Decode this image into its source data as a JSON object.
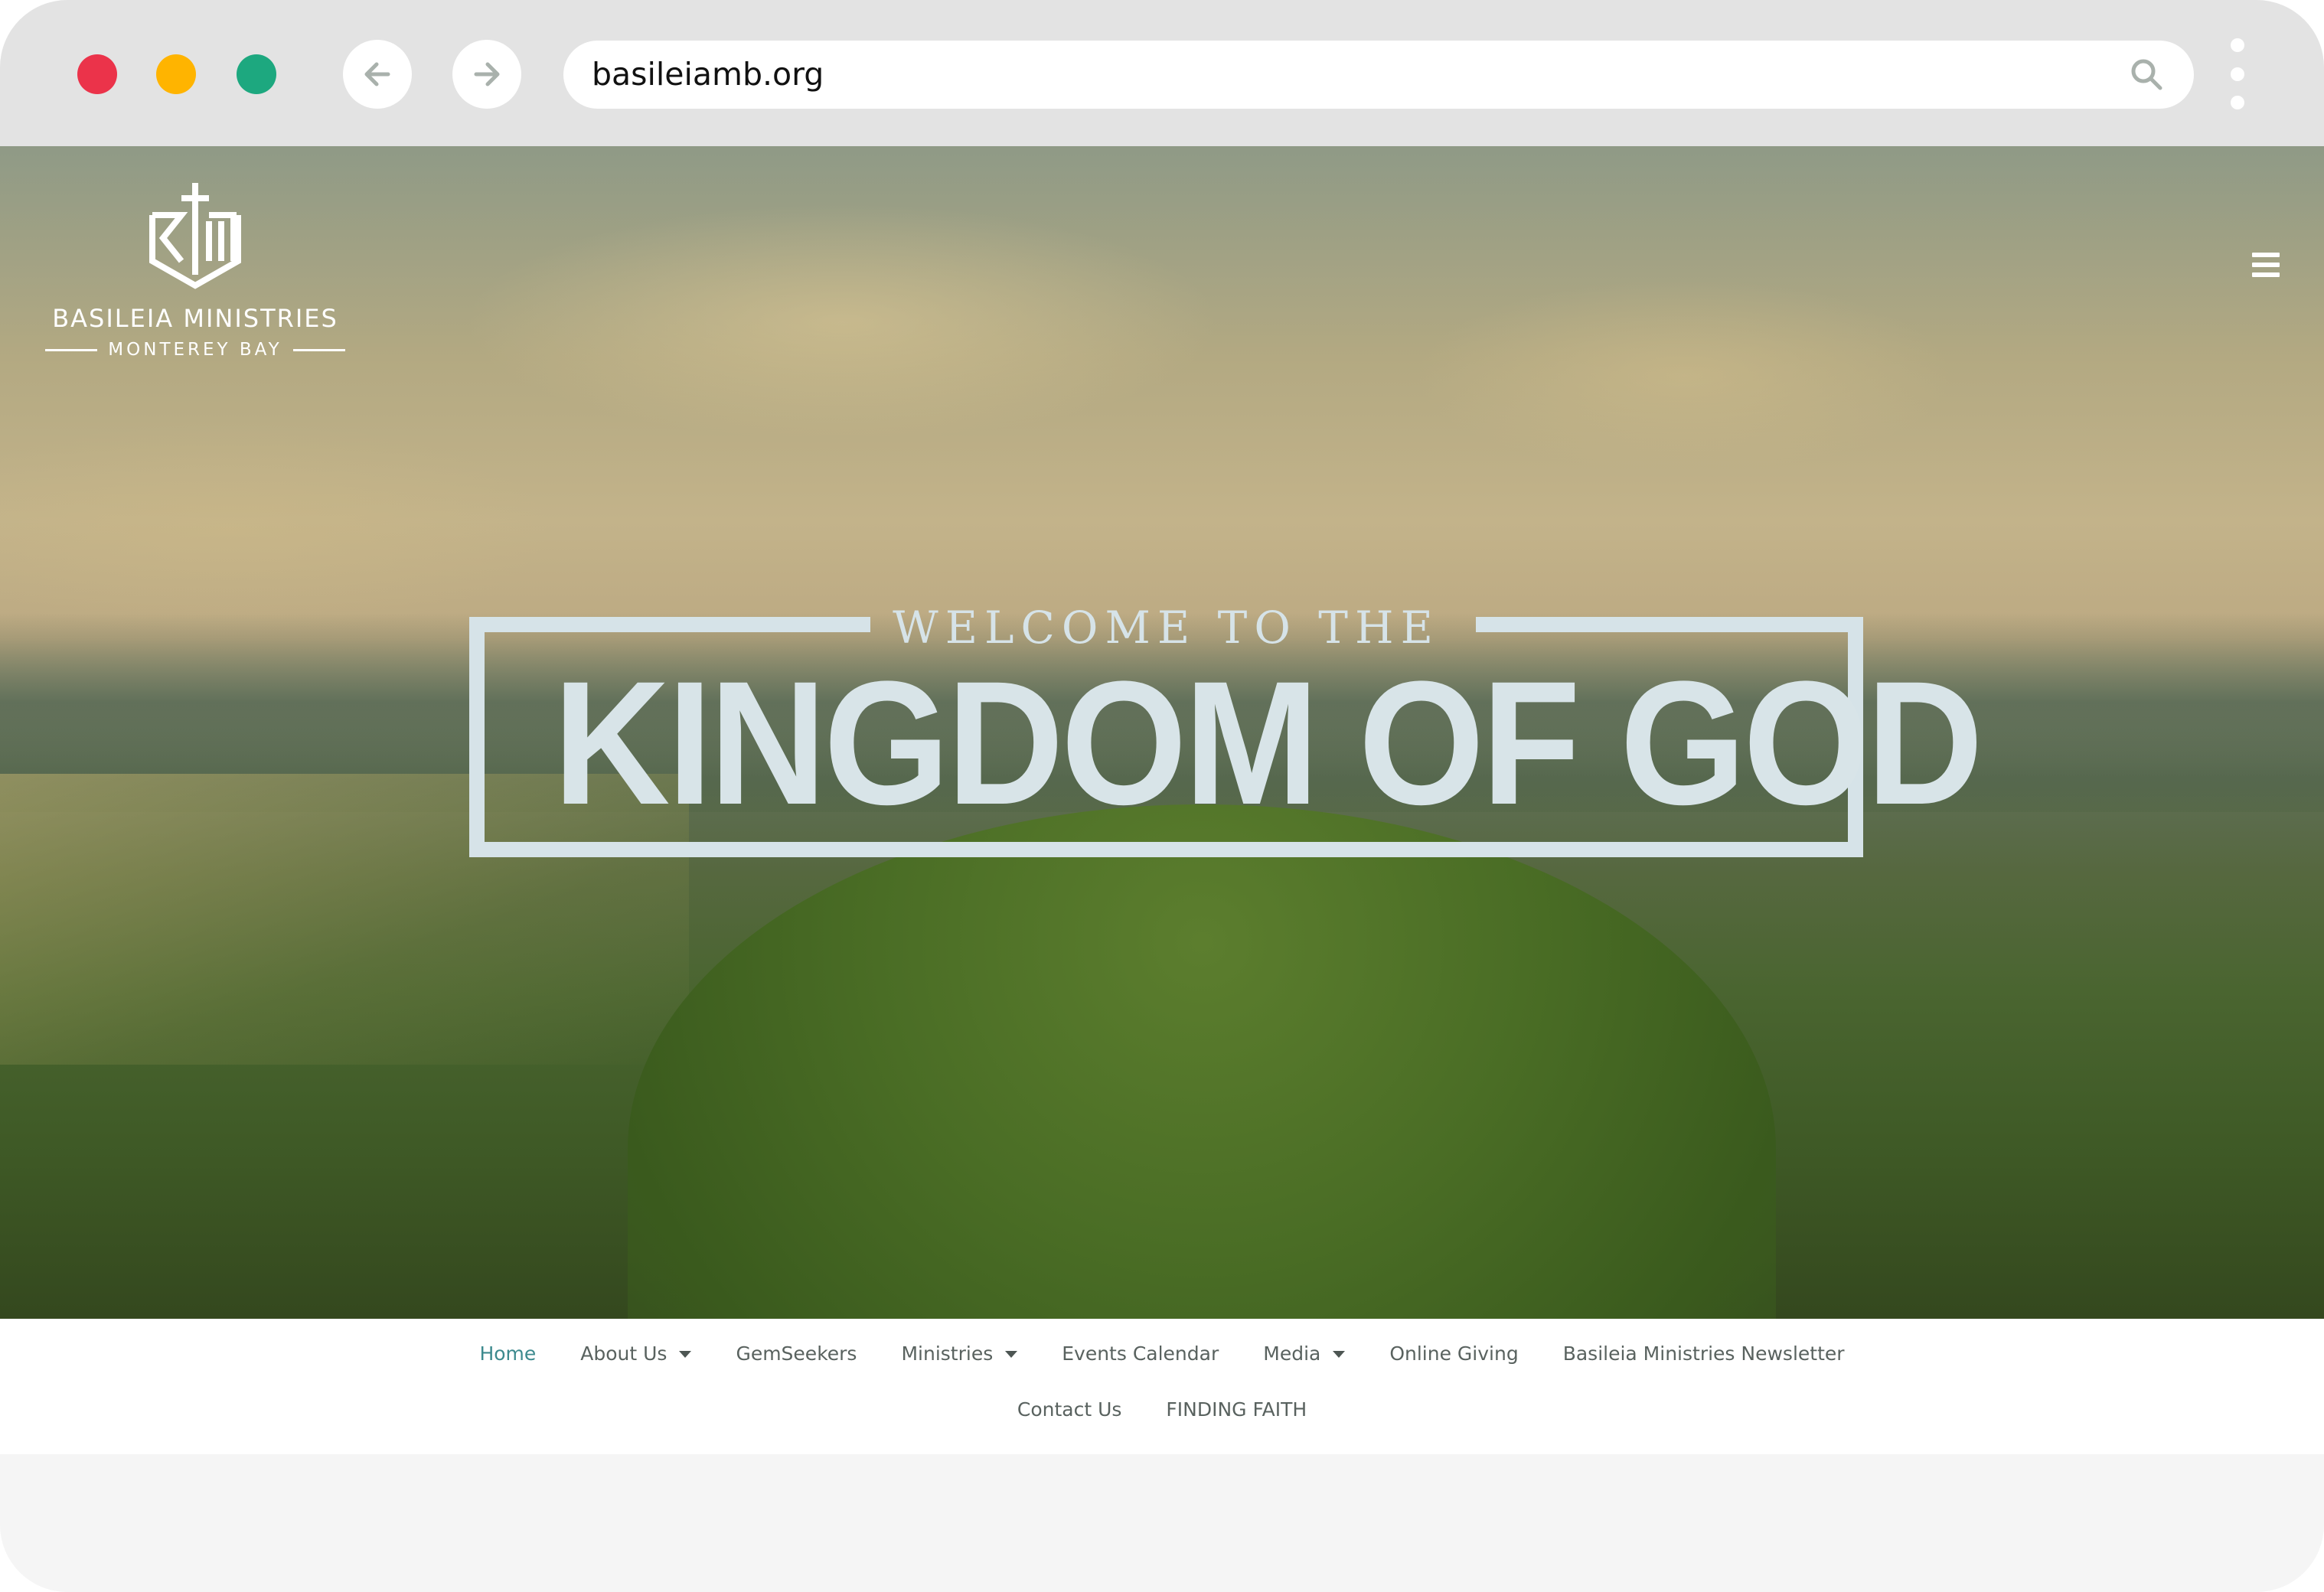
{
  "browser": {
    "url": "basileiamb.org",
    "traffic_lights": {
      "close": "#EB334A",
      "minimize": "#FFB400",
      "maximize": "#1DA87F"
    },
    "back_icon": "arrow-left-icon",
    "forward_icon": "arrow-right-icon",
    "search_icon": "search-icon",
    "menu_icon": "kebab-menu-icon"
  },
  "site": {
    "logo": {
      "mark": "BTM cross shield",
      "name": "BASILEIA MINISTRIES",
      "subtitle": "MONTEREY BAY"
    },
    "hamburger_icon": "hamburger-menu-icon",
    "hero": {
      "kicker": "WELCOME TO THE",
      "headline": "KINGDOM OF GOD"
    },
    "nav": {
      "row1": [
        {
          "label": "Home",
          "active": true,
          "dropdown": false
        },
        {
          "label": "About Us",
          "active": false,
          "dropdown": true
        },
        {
          "label": "GemSeekers",
          "active": false,
          "dropdown": false
        },
        {
          "label": "Ministries",
          "active": false,
          "dropdown": true
        },
        {
          "label": "Events Calendar",
          "active": false,
          "dropdown": false
        },
        {
          "label": "Media",
          "active": false,
          "dropdown": true
        },
        {
          "label": "Online Giving",
          "active": false,
          "dropdown": false
        },
        {
          "label": "Basileia Ministries Newsletter",
          "active": false,
          "dropdown": false
        }
      ],
      "row2": [
        {
          "label": "Contact Us",
          "active": false,
          "dropdown": false
        },
        {
          "label": "FINDING FAITH",
          "active": false,
          "dropdown": false
        }
      ]
    },
    "colors": {
      "nav_active": "#3D8A8E",
      "nav_text": "#59625F",
      "hero_text": "#D8E4E8"
    }
  }
}
